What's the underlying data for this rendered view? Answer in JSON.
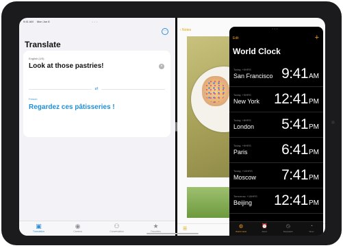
{
  "status_bar": {
    "time": "9:41 AM",
    "date": "Mon Jun 8"
  },
  "translate": {
    "title": "Translate",
    "more_glyph": "···",
    "source_language": "English (US)",
    "source_text": "Look at those pastries!",
    "swap_glyph": "⇄",
    "target_language": "French",
    "target_text": "Regardez ces pâtisseries !",
    "tabs": [
      {
        "label": "Translation",
        "icon": "translate-icon",
        "glyph": "▣",
        "active": true
      },
      {
        "label": "Camera",
        "icon": "camera-icon",
        "glyph": "◉",
        "active": false
      },
      {
        "label": "Conversation",
        "icon": "people-icon",
        "glyph": "⚇",
        "active": false
      },
      {
        "label": "Favorites",
        "icon": "star-icon",
        "glyph": "★",
        "active": false
      }
    ]
  },
  "notes": {
    "back_label": "‹ Notes",
    "bottom_icon": "checklist-icon",
    "bottom_glyph": "☰"
  },
  "world_clock": {
    "edit_label": "Edit",
    "add_glyph": "+",
    "title": "World Clock",
    "cities": [
      {
        "offset": "Today, +0HRS",
        "name": "San Francisco",
        "time": "9:41",
        "ampm": "AM"
      },
      {
        "offset": "Today, +3HRS",
        "name": "New York",
        "time": "12:41",
        "ampm": "PM"
      },
      {
        "offset": "Today, +8HRS",
        "name": "London",
        "time": "5:41",
        "ampm": "PM"
      },
      {
        "offset": "Today, +9HRS",
        "name": "Paris",
        "time": "6:41",
        "ampm": "PM"
      },
      {
        "offset": "Today, +10HRS",
        "name": "Moscow",
        "time": "7:41",
        "ampm": "PM"
      },
      {
        "offset": "Tomorrow, +15HRS",
        "name": "Beijing",
        "time": "12:41",
        "ampm": "PM"
      }
    ],
    "tabs": [
      {
        "label": "World Clock",
        "icon": "globe-icon",
        "glyph": "◍",
        "active": true
      },
      {
        "label": "Alarm",
        "icon": "alarm-icon",
        "glyph": "⏰",
        "active": false
      },
      {
        "label": "Stopwatch",
        "icon": "stopwatch-icon",
        "glyph": "◷",
        "active": false
      },
      {
        "label": "Timer",
        "icon": "timer-icon",
        "glyph": "◔",
        "active": false
      }
    ]
  },
  "colors": {
    "accent_blue": "#2f8fd8",
    "accent_orange": "#f7a21a",
    "notes_yellow": "#e0a400"
  }
}
